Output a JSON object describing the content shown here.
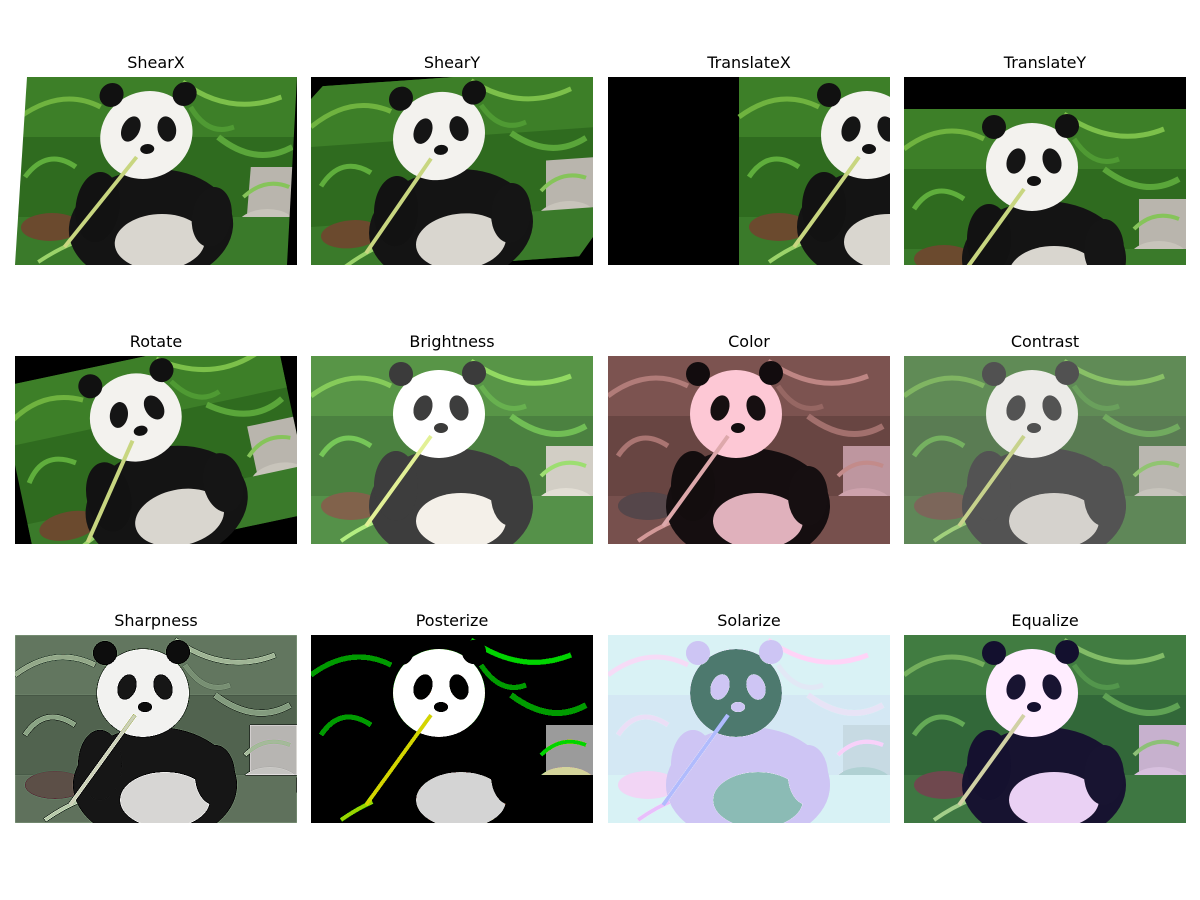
{
  "panels": [
    {
      "title": "ShearX",
      "effect": "shearx"
    },
    {
      "title": "ShearY",
      "effect": "sheary"
    },
    {
      "title": "TranslateX",
      "effect": "translatex"
    },
    {
      "title": "TranslateY",
      "effect": "translatey"
    },
    {
      "title": "Rotate",
      "effect": "rotate"
    },
    {
      "title": "Brightness",
      "effect": "brightness"
    },
    {
      "title": "Color",
      "effect": "color"
    },
    {
      "title": "Contrast",
      "effect": "contrast"
    },
    {
      "title": "Sharpness",
      "effect": "sharpness"
    },
    {
      "title": "Posterize",
      "effect": "posterize"
    },
    {
      "title": "Solarize",
      "effect": "solarize"
    },
    {
      "title": "Equalize",
      "effect": "equalize"
    }
  ]
}
